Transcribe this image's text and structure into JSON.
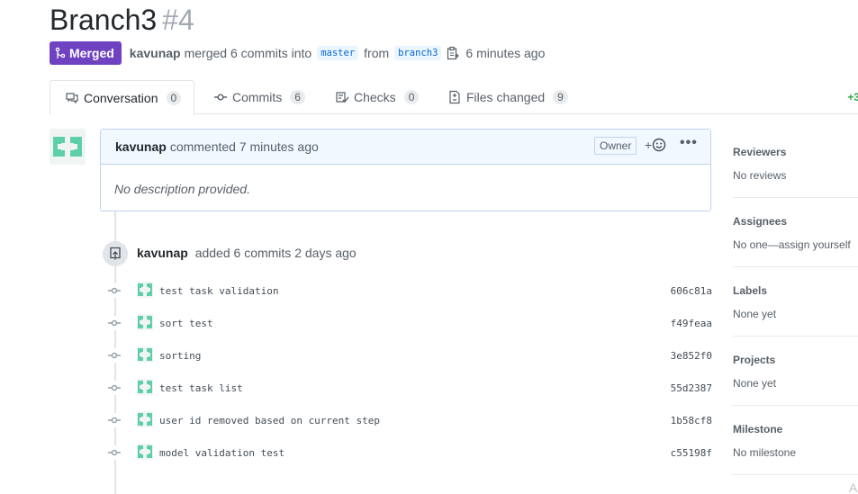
{
  "header": {
    "title": "Branch3",
    "number": "#4",
    "state_label": "Merged",
    "author": "kavunap",
    "merge_text": "merged 6 commits into",
    "base_branch": "master",
    "from_text": "from",
    "head_branch": "branch3",
    "time_ago": "6 minutes ago"
  },
  "tabs": [
    {
      "label": "Conversation",
      "count": "0",
      "icon": "comment-discussion-icon"
    },
    {
      "label": "Commits",
      "count": "6",
      "icon": "git-commit-icon"
    },
    {
      "label": "Checks",
      "count": "0",
      "icon": "checklist-icon"
    },
    {
      "label": "Files changed",
      "count": "9",
      "icon": "file-diff-icon"
    }
  ],
  "diffstat": "+3",
  "comment": {
    "author": "kavunap",
    "action": "commented 7 minutes ago",
    "role_badge": "Owner",
    "reaction_plus": "+",
    "body": "No description provided."
  },
  "commit_event": {
    "author": "kavunap",
    "action": "added 6 commits 2 days ago"
  },
  "commits": [
    {
      "message": "test task validation",
      "sha": "606c81a"
    },
    {
      "message": "sort test",
      "sha": "f49feaa"
    },
    {
      "message": "sorting",
      "sha": "3e852f0"
    },
    {
      "message": "test task list",
      "sha": "55d2387"
    },
    {
      "message": "user id removed based on current step",
      "sha": "1b58cf8"
    },
    {
      "message": "model validation test",
      "sha": "c55198f"
    }
  ],
  "sidebar": [
    {
      "heading": "Reviewers",
      "value": "No reviews"
    },
    {
      "heading": "Assignees",
      "value": "No one—assign yourself"
    },
    {
      "heading": "Labels",
      "value": "None yet"
    },
    {
      "heading": "Projects",
      "value": "None yet"
    },
    {
      "heading": "Milestone",
      "value": "No milestone"
    }
  ],
  "corner_char": "A",
  "colors": {
    "merged": "#6f42c1",
    "identicon": "#5fcfa8",
    "comment_header_bg": "#f1f8ff",
    "diff_added": "#28a745"
  }
}
